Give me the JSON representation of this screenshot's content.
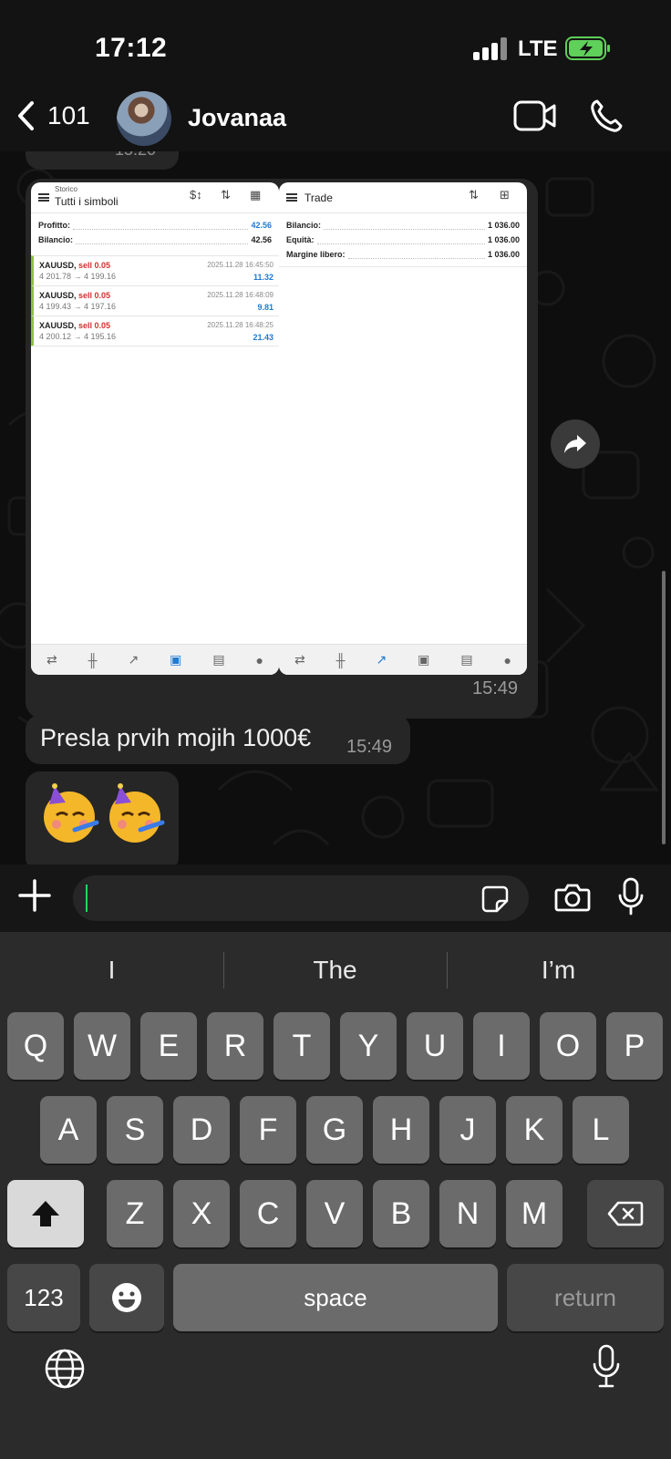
{
  "status_bar": {
    "time": "17:12",
    "network": "LTE"
  },
  "header": {
    "back_count": "101",
    "contact_name": "Jovanaa"
  },
  "chat": {
    "previous_message_time": "15:20",
    "media_message": {
      "time": "15:49",
      "left_screenshot": {
        "subtitle": "Storico",
        "title": "Tutti i simboli",
        "summary": [
          {
            "label": "Profitto:",
            "value": "42.56"
          },
          {
            "label": "Bilancio:",
            "value": "42.56"
          }
        ],
        "deals": [
          {
            "symbol": "XAUUSD,",
            "action": "sell 0.05",
            "prices": "4 201.78 → 4 199.16",
            "datetime": "2025.11.28 16:45:50",
            "profit": "11.32"
          },
          {
            "symbol": "XAUUSD,",
            "action": "sell 0.05",
            "prices": "4 199.43 → 4 197.16",
            "datetime": "2025.11.28 16:48:09",
            "profit": "9.81"
          },
          {
            "symbol": "XAUUSD,",
            "action": "sell 0.05",
            "prices": "4 200.12 → 4 195.16",
            "datetime": "2025.11.28 16:48:25",
            "profit": "21.43"
          }
        ]
      },
      "right_screenshot": {
        "title": "Trade",
        "summary": [
          {
            "label": "Bilancio:",
            "value": "1 036.00"
          },
          {
            "label": "Equità:",
            "value": "1 036.00"
          },
          {
            "label": "Margine libero:",
            "value": "1 036.00"
          }
        ]
      }
    },
    "text_message": {
      "text": "Presla prvih mojih 1000€",
      "time": "15:49"
    },
    "emoji_message": {
      "emojis": [
        "party-face",
        "party-face"
      ]
    }
  },
  "composer": {
    "value": "",
    "accent_color": "#25d366"
  },
  "keyboard": {
    "suggestions": [
      "I",
      "The",
      "I’m"
    ],
    "row1": [
      "Q",
      "W",
      "E",
      "R",
      "T",
      "Y",
      "U",
      "I",
      "O",
      "P"
    ],
    "row2": [
      "A",
      "S",
      "D",
      "F",
      "G",
      "H",
      "J",
      "K",
      "L"
    ],
    "row3": [
      "Z",
      "X",
      "C",
      "V",
      "B",
      "N",
      "M"
    ],
    "numbers_key": "123",
    "space_key": "space",
    "return_key": "return"
  },
  "colors": {
    "background": "#0e0e0e",
    "bubble": "#262626",
    "mt_blue": "#1f7bd6",
    "mt_red": "#d62f2f"
  }
}
